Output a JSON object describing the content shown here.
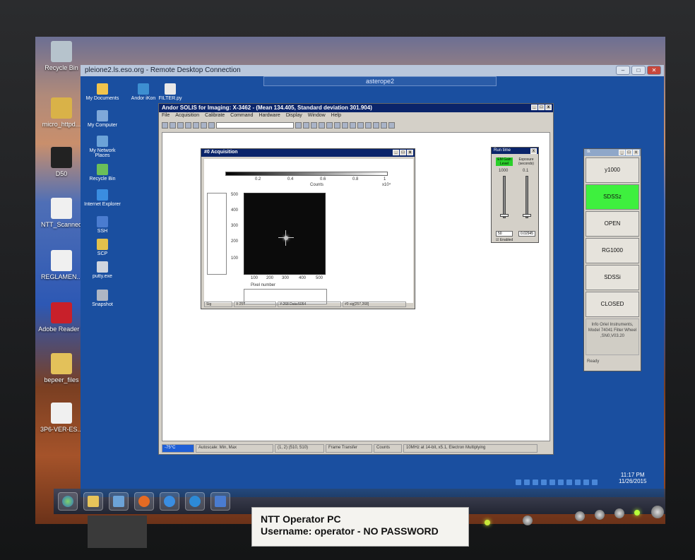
{
  "desktop": {
    "icons": [
      "Recycle Bin",
      "micro_httpd...",
      "D50",
      "NTT_Scanned",
      "REGLAMEN...",
      "Adobe Reader 9",
      "bepeer_files",
      "3P6-VER-ES..."
    ]
  },
  "rdc": {
    "title": "pleione2.ls.eso.org - Remote Desktop Connection",
    "connection_bar": "asterope2"
  },
  "remote_desktop": {
    "icons": [
      "My Documents",
      "My Computer",
      "My Network Places",
      "Recycle Bin",
      "Internet Explorer",
      "SSH",
      "SCP",
      "putty.exe",
      "Snapshot",
      "Andor iKon",
      "FILTER.py"
    ]
  },
  "solis": {
    "title": "Andor SOLIS for Imaging: X-3462 - (Mean 134.405, Standard deviation 301.904)",
    "menu": [
      "File",
      "Acquisition",
      "Calibrate",
      "Command",
      "Hardware",
      "Display",
      "Window",
      "Help"
    ],
    "status": {
      "temp": "-75°C",
      "autoscale": "Autoscale: Min, Max",
      "region": "(1, 2) (510, 510)",
      "mode": "Frame Transfer",
      "units": "Counts",
      "readout": "10MHz at 14-bit, x5.1, Electron Multiplying"
    }
  },
  "acquisition": {
    "title": "#0 Acquisition",
    "colorbar_ticks": [
      "0.2",
      "0.4",
      "0.6",
      "0.8",
      "1"
    ],
    "colorbar_label": "Counts",
    "colorbar_exp": "x10⁴",
    "y_ticks": [
      "500",
      "400",
      "300",
      "200",
      "100"
    ],
    "x_ticks": [
      "100",
      "200",
      "300",
      "400",
      "500"
    ],
    "x_label": "Pixel number",
    "status": {
      "sig": "Sig",
      "x": "X:257",
      "y": "Y:268 Data:5054",
      "sig2": "#0 sig[257,268]"
    }
  },
  "runtime": {
    "title": "Run time",
    "emgain_label": "EM Gain Level",
    "exposure_label": "Exposure (seconds)",
    "emgain_max": "1000",
    "exposure_max": "0.1",
    "emgain_value": "50",
    "exposure_value": "0.02945",
    "enabled": "Enabled"
  },
  "filter": {
    "title": "tk",
    "buttons": [
      {
        "label": "y1000",
        "active": false
      },
      {
        "label": "SDSSz",
        "active": true
      },
      {
        "label": "OPEN",
        "active": false
      },
      {
        "label": "RG1000",
        "active": false
      },
      {
        "label": "SDSSi",
        "active": false
      },
      {
        "label": "CLOSED",
        "active": false
      }
    ],
    "info": "Info Oriel Instruments, Model 74041 Filter Wheel ,SN0,V03.20",
    "ready": "Ready"
  },
  "clock": {
    "time": "11:17 PM",
    "date": "11/26/2015"
  },
  "plate": {
    "line1": "NTT Operator PC",
    "line2": "Username: operator  - NO PASSWORD"
  },
  "colors": {
    "accent": "#0a246a",
    "active": "#3ef03e",
    "temp": "#1f5fd6"
  }
}
